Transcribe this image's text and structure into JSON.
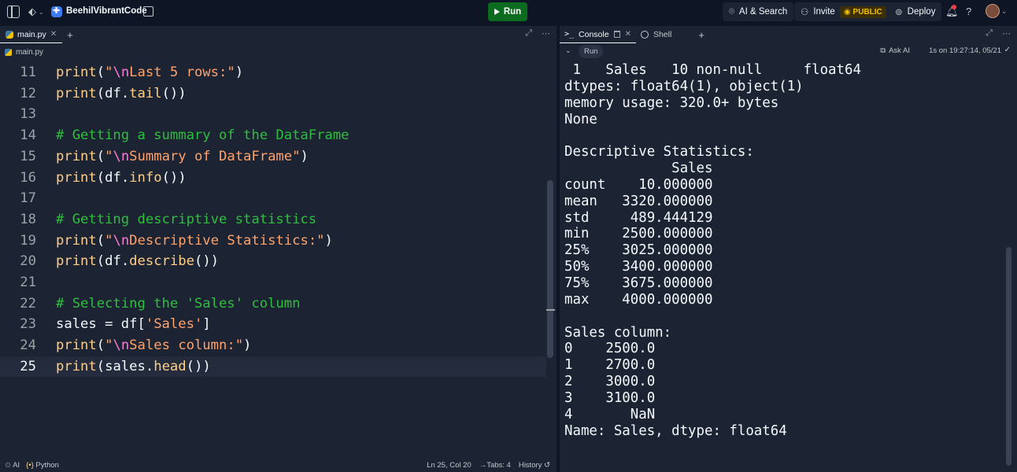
{
  "topbar": {
    "repl_name": "BeehilVibrantCode",
    "run_label": "Run",
    "ai_search_label": "AI & Search",
    "invite_label": "Invite",
    "public_label": "PUBLIC",
    "deploy_label": "Deploy"
  },
  "editor": {
    "tab_label": "main.py",
    "breadcrumb": "main.py",
    "lines": [
      {
        "n": "11",
        "tokens": [
          [
            "fn",
            "print"
          ],
          [
            "p",
            "("
          ],
          [
            "str",
            "\""
          ],
          [
            "esc",
            "\\n"
          ],
          [
            "str",
            "Last 5 rows:\""
          ],
          [
            "p",
            ")"
          ]
        ]
      },
      {
        "n": "12",
        "tokens": [
          [
            "fn",
            "print"
          ],
          [
            "p",
            "("
          ],
          [
            "id",
            "df"
          ],
          [
            "p",
            "."
          ],
          [
            "fn",
            "tail"
          ],
          [
            "p",
            "())"
          ]
        ]
      },
      {
        "n": "13",
        "tokens": []
      },
      {
        "n": "14",
        "tokens": [
          [
            "com",
            "# Getting a summary of the DataFrame"
          ]
        ]
      },
      {
        "n": "15",
        "tokens": [
          [
            "fn",
            "print"
          ],
          [
            "p",
            "("
          ],
          [
            "str",
            "\""
          ],
          [
            "esc",
            "\\n"
          ],
          [
            "str",
            "Summary of DataFrame\""
          ],
          [
            "p",
            ")"
          ]
        ]
      },
      {
        "n": "16",
        "tokens": [
          [
            "fn",
            "print"
          ],
          [
            "p",
            "("
          ],
          [
            "id",
            "df"
          ],
          [
            "p",
            "."
          ],
          [
            "fn",
            "info"
          ],
          [
            "p",
            "())"
          ]
        ]
      },
      {
        "n": "17",
        "tokens": []
      },
      {
        "n": "18",
        "tokens": [
          [
            "com",
            "# Getting descriptive statistics"
          ]
        ]
      },
      {
        "n": "19",
        "tokens": [
          [
            "fn",
            "print"
          ],
          [
            "p",
            "("
          ],
          [
            "str",
            "\""
          ],
          [
            "esc",
            "\\n"
          ],
          [
            "str",
            "Descriptive Statistics:\""
          ],
          [
            "p",
            ")"
          ]
        ]
      },
      {
        "n": "20",
        "tokens": [
          [
            "fn",
            "print"
          ],
          [
            "p",
            "("
          ],
          [
            "id",
            "df"
          ],
          [
            "p",
            "."
          ],
          [
            "fn",
            "describe"
          ],
          [
            "p",
            "())"
          ]
        ]
      },
      {
        "n": "21",
        "tokens": []
      },
      {
        "n": "22",
        "tokens": [
          [
            "com",
            "# Selecting the 'Sales' column"
          ]
        ]
      },
      {
        "n": "23",
        "tokens": [
          [
            "id",
            "sales "
          ],
          [
            "p",
            "= "
          ],
          [
            "id",
            "df"
          ],
          [
            "p",
            "["
          ],
          [
            "str",
            "'Sales'"
          ],
          [
            "p",
            "]"
          ]
        ]
      },
      {
        "n": "24",
        "tokens": [
          [
            "fn",
            "print"
          ],
          [
            "p",
            "("
          ],
          [
            "str",
            "\""
          ],
          [
            "esc",
            "\\n"
          ],
          [
            "str",
            "Sales column:\""
          ],
          [
            "p",
            ")"
          ]
        ]
      },
      {
        "n": "25",
        "tokens": [
          [
            "fn",
            "print"
          ],
          [
            "p",
            "("
          ],
          [
            "id",
            "sales"
          ],
          [
            "p",
            "."
          ],
          [
            "fn",
            "head"
          ],
          [
            "p",
            "())"
          ]
        ]
      }
    ],
    "current_line": "25",
    "status": {
      "ai": "AI",
      "language": "Python",
      "position": "Ln 25, Col 20",
      "tabs": "Tabs: 4",
      "history": "History"
    }
  },
  "console": {
    "tab_console": "Console",
    "tab_shell": "Shell",
    "run_label": "Run",
    "ask_ai": "Ask AI",
    "run_meta": "1s on 19:27:14, 05/21",
    "output": [
      " 1   Sales   10 non-null     float64",
      "dtypes: float64(1), object(1)",
      "memory usage: 320.0+ bytes",
      "None",
      "",
      "Descriptive Statistics:",
      "             Sales",
      "count    10.000000",
      "mean   3320.000000",
      "std     489.444129",
      "min    2500.000000",
      "25%    3025.000000",
      "50%    3400.000000",
      "75%    3675.000000",
      "max    4000.000000",
      "",
      "Sales column:",
      "0    2500.0",
      "1    2700.0",
      "2    3000.0",
      "3    3100.0",
      "4       NaN",
      "Name: Sales, dtype: float64"
    ]
  }
}
